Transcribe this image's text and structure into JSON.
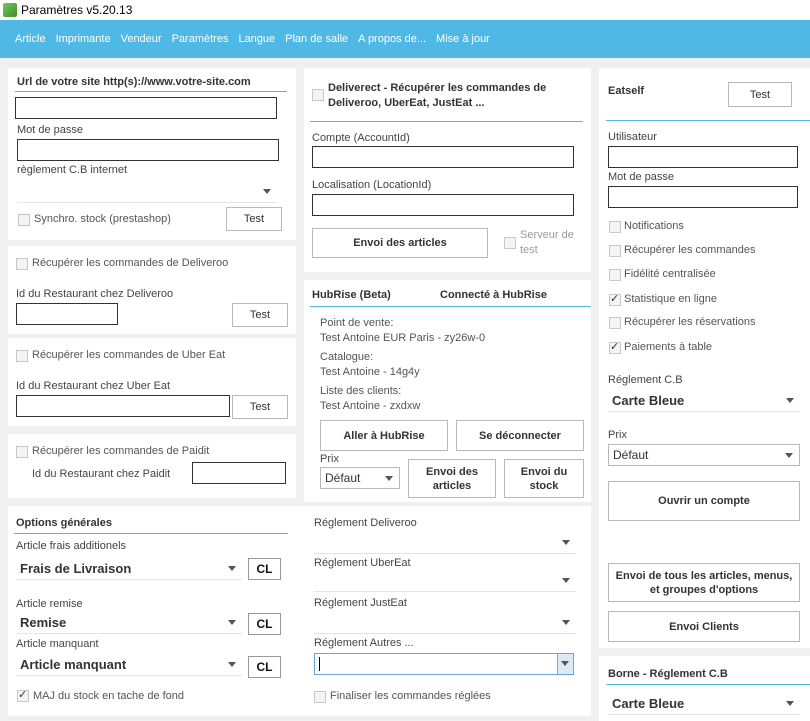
{
  "window": {
    "title": "Paramètres v5.20.13"
  },
  "menu": [
    "Article",
    "Imprimante",
    "Vendeur",
    "Paramètres",
    "Langue",
    "Plan de salle",
    "A propos de...",
    "Mise à jour"
  ],
  "web": {
    "url_label": "Url de votre site http(s)://www.votre-site.com",
    "url_value": "",
    "password_label": "Mot de passe",
    "cb_label": "règlement C.B internet",
    "cb_value": "",
    "sync_label": "Synchro. stock (prestashop)",
    "sync_checked": false,
    "test_label": "Test"
  },
  "deliveroo": {
    "fetch_label": "Récupérer les commandes de Deliveroo",
    "id_label": "Id du Restaurant chez Deliveroo",
    "test_label": "Test"
  },
  "ubereat": {
    "fetch_label": "Récupérer les commandes de Uber Eat",
    "id_label": "Id du Restaurant chez Uber Eat",
    "test_label": "Test"
  },
  "paidit": {
    "fetch_label": "Récupérer les commandes de Paidit",
    "id_label": "Id du Restaurant chez Paidit"
  },
  "deliverect": {
    "title_line1": "Deliverect  - Récupérer les commandes de",
    "title_line2": "Deliveroo, UberEat, JustEat ...",
    "account_label": "Compte (AccountId)",
    "location_label": "Localisation (LocationId)",
    "send_label": "Envoi des articles",
    "test_server_line1": "Serveur de",
    "test_server_line2": "test"
  },
  "hubrise": {
    "title": "HubRise (Beta)",
    "status": "Connecté à HubRise",
    "pos_label": "Point de vente:",
    "pos_value": "Test Antoine EUR Paris - zy26w-0",
    "catalog_label": "Catalogue:",
    "catalog_value": "Test Antoine - 14g4y",
    "clients_label": "Liste des clients:",
    "clients_value": "Test Antoine - zxdxw",
    "go_label": "Aller à HubRise",
    "logout_label": "Se déconnecter",
    "price_label": "Prix",
    "price_value": "Défaut",
    "send_articles_line1": "Envoi des",
    "send_articles_line2": "articles",
    "send_stock_line1": "Envoi du",
    "send_stock_line2": "stock"
  },
  "eatself": {
    "title": "Eatself",
    "test_label": "Test",
    "user_label": "Utilisateur",
    "password_label": "Mot de passe",
    "options": [
      {
        "label": "Notifications",
        "checked": false
      },
      {
        "label": "Récupérer les commandes",
        "checked": false
      },
      {
        "label": "Fidélité centralisée",
        "checked": false
      },
      {
        "label": "Statistique en ligne",
        "checked": true
      },
      {
        "label": "Récupérer les réservations",
        "checked": false
      },
      {
        "label": "Paiements à table",
        "checked": true
      }
    ],
    "cb_label": "Réglement C.B",
    "cb_value": "Carte Bleue",
    "price_label": "Prix",
    "price_value": "Défaut",
    "open_account_label": "Ouvrir un compte",
    "send_all_line1": "Envoi de tous les articles, menus,",
    "send_all_line2": "et groupes d'options",
    "send_clients_label": "Envoi Clients"
  },
  "general": {
    "title": "Options générales",
    "extra_fee_label": "Article frais additionels",
    "extra_fee_value": "Frais de Livraison",
    "discount_label": "Article remise",
    "discount_value": "Remise",
    "missing_label": "Article manquant",
    "missing_value": "Article manquant",
    "cl_label": "CL",
    "stock_label": "MAJ du stock en tache de fond",
    "stock_checked": true
  },
  "payments": {
    "deliveroo_label": "Réglement Deliveroo",
    "ubereat_label": "Réglement UberEat",
    "justeat_label": "Réglement JustEat",
    "others_label": "Réglement Autres ...",
    "finalize_label": "Finaliser les commandes réglées",
    "finalize_checked": false
  },
  "kiosk": {
    "title": "Borne - Réglement C.B",
    "value": "Carte Bleue"
  }
}
